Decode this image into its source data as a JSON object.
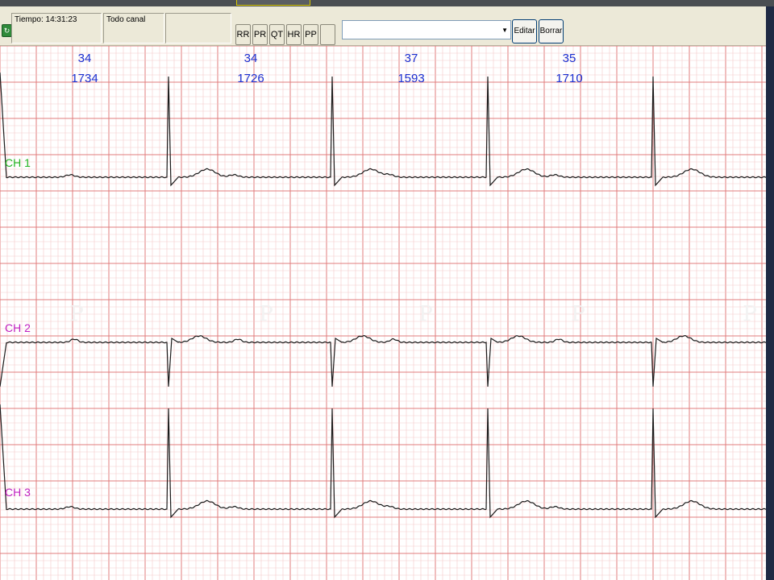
{
  "toolbar": {
    "time_label": "Tiempo: 14:31:23",
    "channel_label": "Todo canal",
    "buttons": [
      "RR",
      "PR",
      "QT",
      "HR",
      "PP",
      ""
    ],
    "select_value": "",
    "edit_label": "Editar",
    "delete_label": "Borrar"
  },
  "intervals": [
    {
      "top": "34",
      "bottom": "1734"
    },
    {
      "top": "34",
      "bottom": "1726"
    },
    {
      "top": "37",
      "bottom": "1593"
    },
    {
      "top": "35",
      "bottom": "1710"
    }
  ],
  "channels": [
    {
      "label": "CH 1",
      "color": "#22b522"
    },
    {
      "label": "CH 2",
      "color": "#c020c0"
    },
    {
      "label": "CH 3",
      "color": "#c020c0"
    }
  ],
  "p_marker": "P",
  "colors": {
    "grid_minor": "#f3c9c9",
    "grid_major": "#e07c7c",
    "trace": "#1a1a1a",
    "interval_text": "#1a2fd0"
  }
}
